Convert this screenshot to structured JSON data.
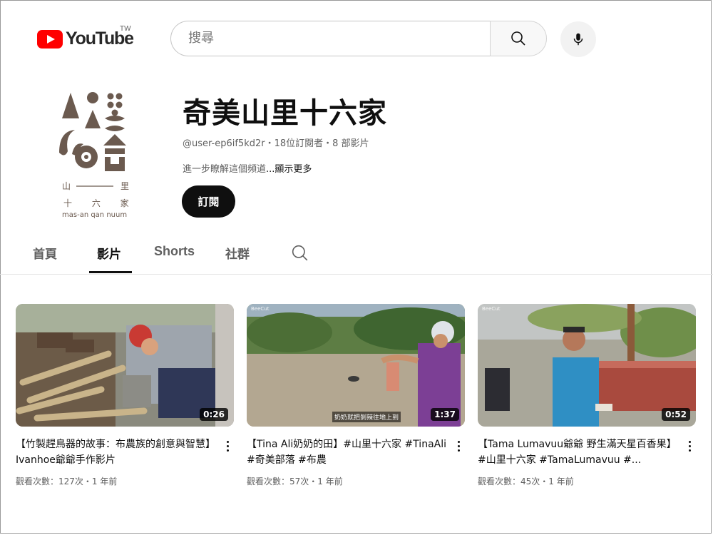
{
  "header": {
    "logo_text": "YouTube",
    "region": "TW",
    "search_placeholder": "搜尋"
  },
  "channel": {
    "name": "奇美山里十六家",
    "handle": "@user-ep6if5kd2r",
    "subscribers": "18位訂閱者",
    "video_count": "8 部影片",
    "meta_separator": "・",
    "description": "進一步瞭解這個頻道",
    "more_label": "...顯示更多",
    "subscribe_label": "訂閱",
    "avatar_text": {
      "line1_left": "山",
      "line1_right": "里",
      "line2": "十 六 家",
      "line3": "mas-an qan nuum"
    }
  },
  "tabs": [
    {
      "label": "首頁",
      "active": false
    },
    {
      "label": "影片",
      "active": true
    },
    {
      "label": "Shorts",
      "active": false
    },
    {
      "label": "社群",
      "active": false
    }
  ],
  "videos": [
    {
      "title": "【竹製趕鳥器的故事：布農族的創意與智慧】Ivanhoe爺爺手作影片",
      "meta": "觀看次數：127次・1 年前",
      "duration": "0:26",
      "overlay": ""
    },
    {
      "title": "【Tina Ali奶奶的田】#山里十六家 #TinaAli #奇美部落 #布農",
      "meta": "觀看次數：57次・1 年前",
      "duration": "1:37",
      "overlay": "奶奶就把剝辣往地上到",
      "watermark": "BeeCut"
    },
    {
      "title": "【Tama Lumavuu爺爺 野生滿天星百香果】#山里十六家 #TamaLumavuu #...",
      "meta": "觀看次數：45次・1 年前",
      "duration": "0:52",
      "overlay": "",
      "watermark": "BeeCut"
    }
  ],
  "colors": {
    "brand_red": "#ff0000",
    "avatar_brown": "#6b5a4f",
    "text_primary": "#0f0f0f",
    "text_secondary": "#606060"
  }
}
